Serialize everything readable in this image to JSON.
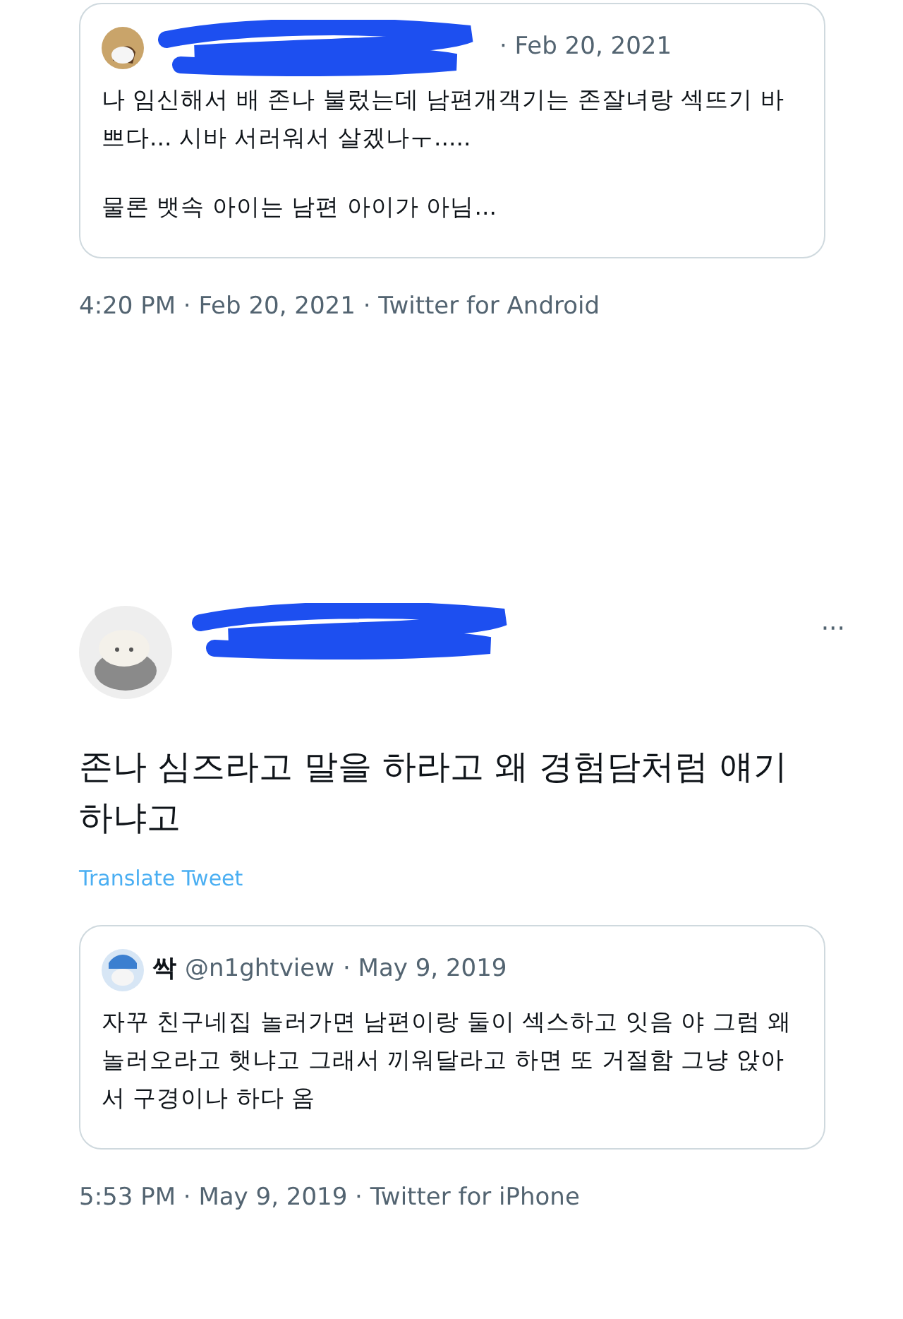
{
  "first_tweet": {
    "quoted_tweet": {
      "date": "· Feb 20, 2021",
      "paragraphs": [
        "나 임신해서 배 존나 불렀는데 남편개객기는 존잘녀랑 섹뜨기 바쁘다... 시바 서러워서 살겠나ㅜ.....",
        "물론 뱃속 아이는 남편 아이가 아님..."
      ]
    },
    "timestamp": "4:20 PM · Feb 20, 2021 · Twitter for Android"
  },
  "second_tweet": {
    "more": "···",
    "text": "존나 심즈라고 말을 하라고 왜 경험담처럼 얘기하냐고",
    "translate": "Translate Tweet",
    "quoted_tweet": {
      "name": "싹",
      "handle": "@n1ghtview",
      "date": "· May 9, 2019",
      "paragraphs": [
        "자꾸 친구네집 놀러가면 남편이랑 둘이 섹스하고 잇음 야 그럼 왜 놀러오라고 햇냐고 그래서 끼워달라고 하면 또 거절함 그냥 앉아서 구경이나 하다 옴"
      ]
    },
    "timestamp": "5:53 PM · May 9, 2019 · Twitter for iPhone"
  }
}
